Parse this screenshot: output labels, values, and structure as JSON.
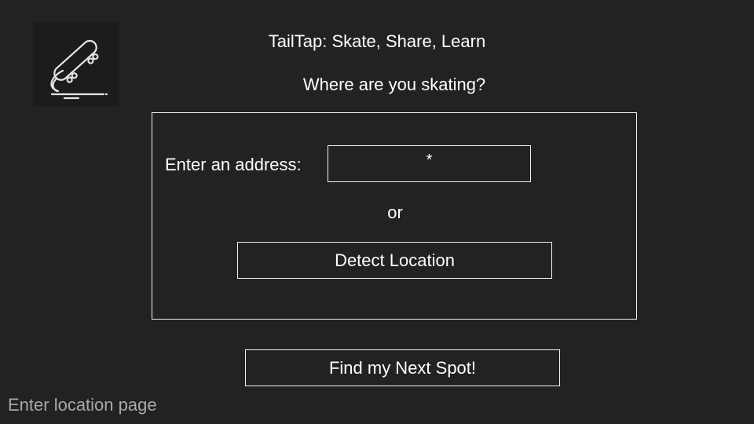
{
  "app": {
    "title": "TailTap: Skate, Share, Learn",
    "logo_icon": "skateboard-icon"
  },
  "prompt": {
    "question": "Where are you skating?"
  },
  "location_form": {
    "address_label": "Enter an address:",
    "address_input_value": "*",
    "separator_text": "or",
    "detect_button_label": "Detect Location"
  },
  "actions": {
    "find_button_label": "Find my Next Spot!"
  },
  "page_caption": "Enter location page",
  "colors": {
    "background": "#222222",
    "foreground": "#ffffff",
    "border": "#f2f2f2",
    "caption": "#a9a9a9"
  }
}
